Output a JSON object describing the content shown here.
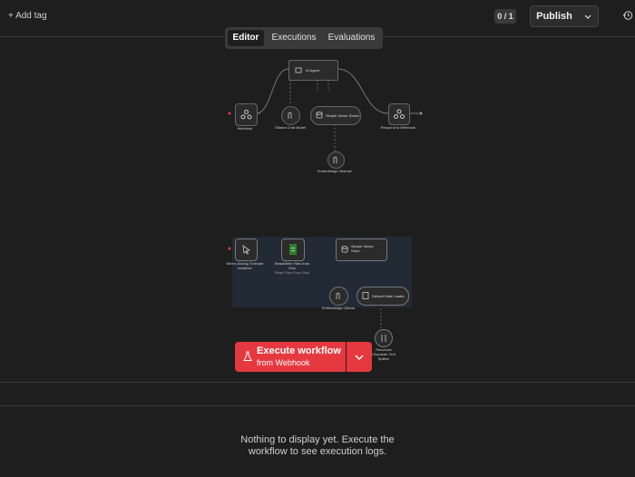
{
  "header": {
    "add_tag": "+ Add tag",
    "counter": "0 / 1",
    "publish_label": "Publish"
  },
  "tabs": [
    {
      "label": "Editor",
      "active": true
    },
    {
      "label": "Executions",
      "active": false
    },
    {
      "label": "Evaluations",
      "active": false
    }
  ],
  "workflow_top": {
    "ai_agent": "AI Agent",
    "webhook": "Webhook",
    "chat_model": "Ollama Chat Model",
    "vector_store": "Simple Vector Store1",
    "respond": "Respond to Webhook",
    "embeddings": "Embeddings Ollama1"
  },
  "workflow_bottom": {
    "trigger": "When clicking 'Execute workflow'",
    "read_files": "Read/Write Files from Disk",
    "read_files_sub": "Read Files From Disk",
    "vector_store": "Simple Vector Store",
    "embeddings": "Embeddings Ollama",
    "data_loader": "Default Data Loader",
    "splitter": "Recursive Character Text Splitter"
  },
  "execute": {
    "title": "Execute workflow",
    "subtitle": "from Webhook"
  },
  "logs": {
    "empty_line1": "Nothing to display yet. Execute the",
    "empty_line2": "workflow to see execution logs."
  },
  "colors": {
    "accent_red": "#e5393f",
    "green_node": "#2e7d32",
    "background": "#1e1e1e"
  }
}
